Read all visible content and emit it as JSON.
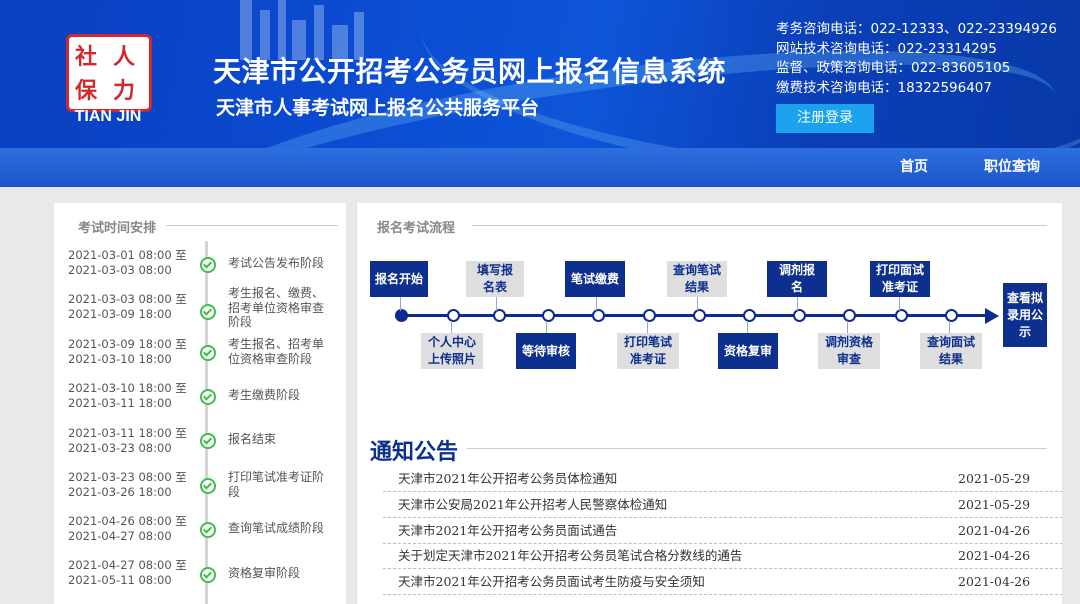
{
  "header": {
    "logo_text": "TIAN JIN",
    "logo_seal_chars": [
      "人",
      "力",
      "社",
      "保"
    ],
    "title": "天津市公开招考公务员网上报名信息系统",
    "subtitle": "天津市人事考试网上报名公共服务平台",
    "contacts": [
      "考务咨询电话：022-12333、022-23394926",
      "网站技术咨询电话：022-23314295",
      "监督、政策咨询电话：022-83605105",
      "缴费技术咨询电话：18322596407"
    ],
    "login_label": "注册登录"
  },
  "nav": {
    "home": "首页",
    "job_search": "职位查询"
  },
  "schedule": {
    "title": "考试时间安排",
    "items": [
      {
        "date1": "2021-03-01 08:00 至",
        "date2": "2021-03-03 08:00",
        "label": "考试公告发布阶段"
      },
      {
        "date1": "2021-03-03 08:00 至",
        "date2": "2021-03-09 18:00",
        "label": "考生报名、缴费、招考单位资格审查阶段"
      },
      {
        "date1": "2021-03-09 18:00 至",
        "date2": "2021-03-10 18:00",
        "label": "考生报名、招考单位资格审查阶段"
      },
      {
        "date1": "2021-03-10 18:00 至",
        "date2": "2021-03-11 18:00",
        "label": "考生缴费阶段"
      },
      {
        "date1": "2021-03-11 18:00 至",
        "date2": "2021-03-23 08:00",
        "label": "报名结束"
      },
      {
        "date1": "2021-03-23 08:00 至",
        "date2": "2021-03-26 18:00",
        "label": "打印笔试准考证阶段"
      },
      {
        "date1": "2021-04-26 08:00 至",
        "date2": "2021-04-27 08:00",
        "label": "查询笔试成绩阶段"
      },
      {
        "date1": "2021-04-27 08:00 至",
        "date2": "2021-05-11 08:00",
        "label": "资格复审阶段"
      }
    ]
  },
  "flow": {
    "title": "报名考试流程",
    "steps_top": [
      "报名开始",
      "填写报名表",
      "笔试缴费",
      "查询笔试结果",
      "调剂报名",
      "打印面试准考证"
    ],
    "steps_bottom": [
      "个人中心上传照片",
      "等待审核",
      "打印笔试准考证",
      "资格复审",
      "调剂资格审查",
      "查询面试结果"
    ],
    "end": "查看拟录用公示"
  },
  "notices": {
    "title": "通知公告",
    "items": [
      {
        "title": "天津市2021年公开招考公务员体检通知",
        "date": "2021-05-29"
      },
      {
        "title": "天津市公安局2021年公开招考人民警察体检通知",
        "date": "2021-05-29"
      },
      {
        "title": "天津市2021年公开招考公务员面试通告",
        "date": "2021-04-26"
      },
      {
        "title": "关于划定天津市2021年公开招考公务员笔试合格分数线的通告",
        "date": "2021-04-26"
      },
      {
        "title": "天津市2021年公开招考公务员面试考生防疫与安全须知",
        "date": "2021-04-26"
      }
    ]
  },
  "colors": {
    "primary": "#0d2f8e",
    "header_blue": "#0b4ad0",
    "button_blue": "#1aa2ee",
    "check_green": "#3fbf4a"
  }
}
